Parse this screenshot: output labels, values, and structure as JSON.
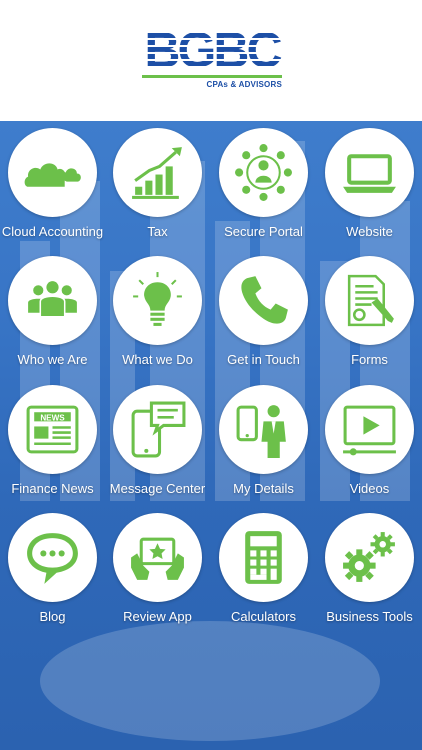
{
  "logo": {
    "letters": "BGBC",
    "tagline": "CPAs & ADVISORS"
  },
  "tiles": [
    {
      "label": "Cloud Accounting",
      "icon": "cloud-icon"
    },
    {
      "label": "Tax",
      "icon": "growth-chart-icon"
    },
    {
      "label": "Secure Portal",
      "icon": "network-people-icon"
    },
    {
      "label": "Website",
      "icon": "laptop-icon"
    },
    {
      "label": "Who we Are",
      "icon": "team-icon"
    },
    {
      "label": "What we Do",
      "icon": "lightbulb-icon"
    },
    {
      "label": "Get in Touch",
      "icon": "phone-icon"
    },
    {
      "label": "Forms",
      "icon": "document-form-icon"
    },
    {
      "label": "Finance News",
      "icon": "newspaper-icon"
    },
    {
      "label": "Message Center",
      "icon": "mobile-message-icon"
    },
    {
      "label": "My Details",
      "icon": "person-phone-icon"
    },
    {
      "label": "Videos",
      "icon": "video-play-icon"
    },
    {
      "label": "Blog",
      "icon": "chat-bubble-icon"
    },
    {
      "label": "Review App",
      "icon": "tablet-star-icon"
    },
    {
      "label": "Calculators",
      "icon": "calculator-icon"
    },
    {
      "label": "Business Tools",
      "icon": "gears-icon"
    }
  ],
  "colors": {
    "accent": "#6cc04a",
    "brand": "#1d4fa6",
    "background": "#3572c2"
  }
}
